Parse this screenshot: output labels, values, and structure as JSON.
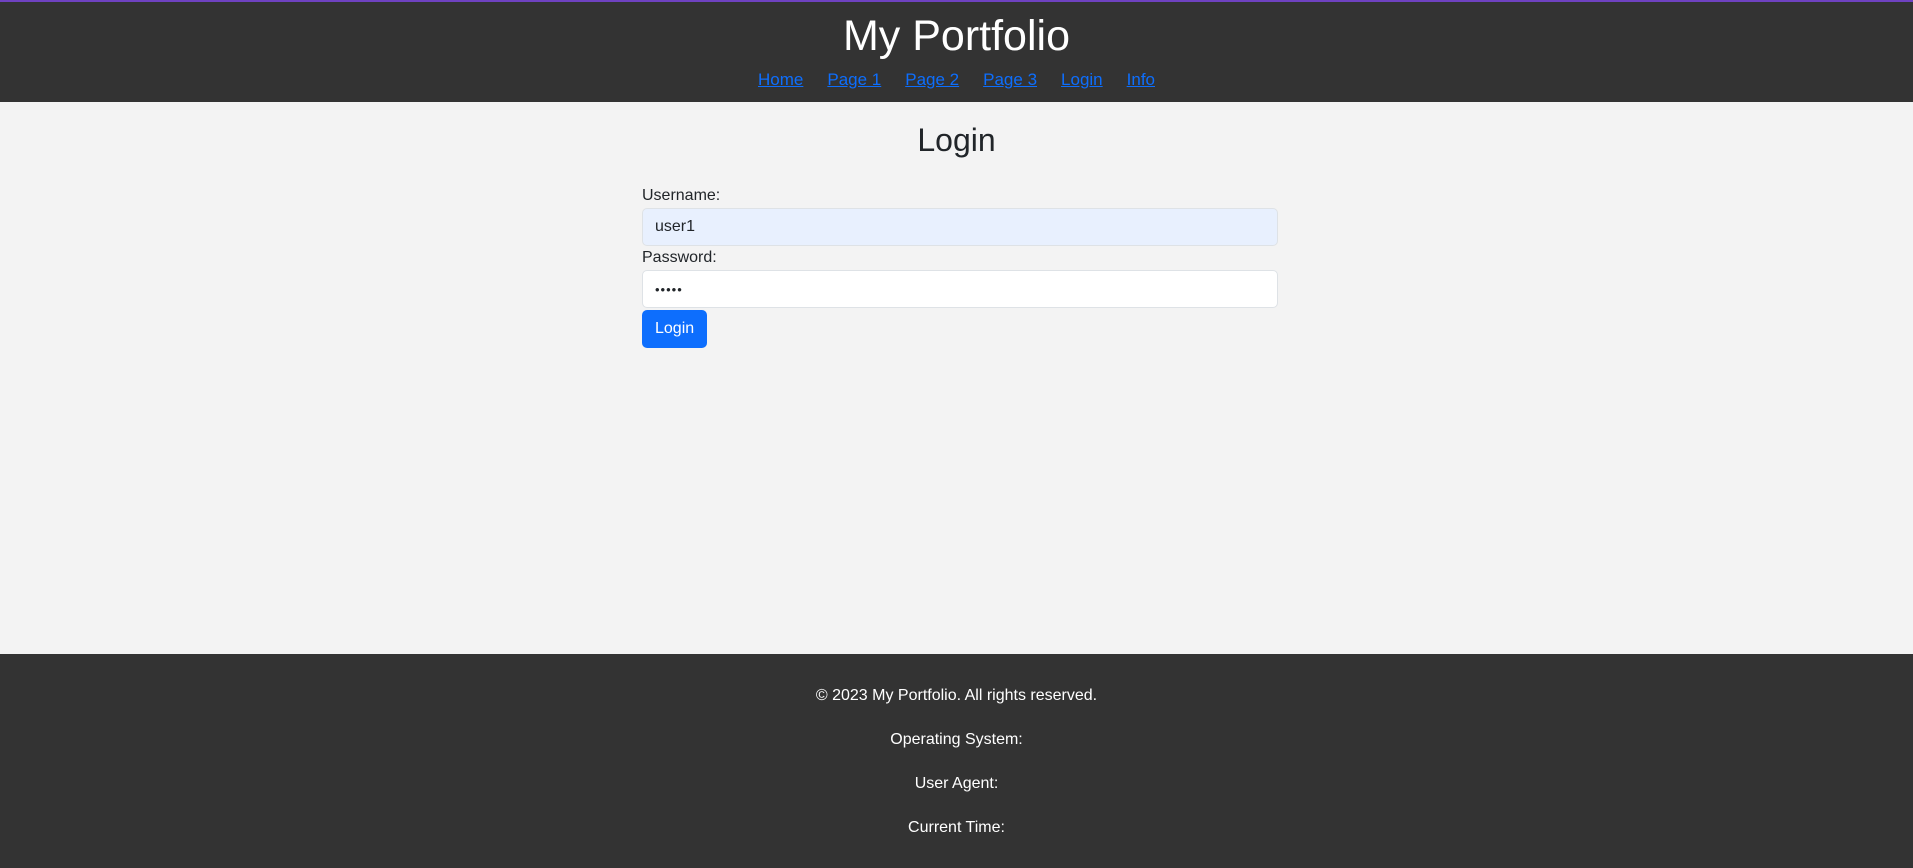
{
  "header": {
    "title": "My Portfolio",
    "nav": [
      {
        "label": "Home"
      },
      {
        "label": "Page 1"
      },
      {
        "label": "Page 2"
      },
      {
        "label": "Page 3"
      },
      {
        "label": "Login"
      },
      {
        "label": "Info"
      }
    ]
  },
  "login": {
    "title": "Login",
    "username_label": "Username:",
    "username_value": "user1",
    "password_label": "Password:",
    "password_value": "•••••",
    "button_label": "Login"
  },
  "footer": {
    "copyright": "© 2023 My Portfolio. All rights reserved.",
    "os_label": "Operating System:",
    "user_agent_label": "User Agent:",
    "current_time_label": "Current Time:"
  },
  "colors": {
    "header_bg": "#333333",
    "accent_border": "#6f42c1",
    "link": "#0d6efd",
    "button": "#0d6efd",
    "page_bg": "#f3f3f3",
    "autofill_bg": "#e8f0fe"
  }
}
